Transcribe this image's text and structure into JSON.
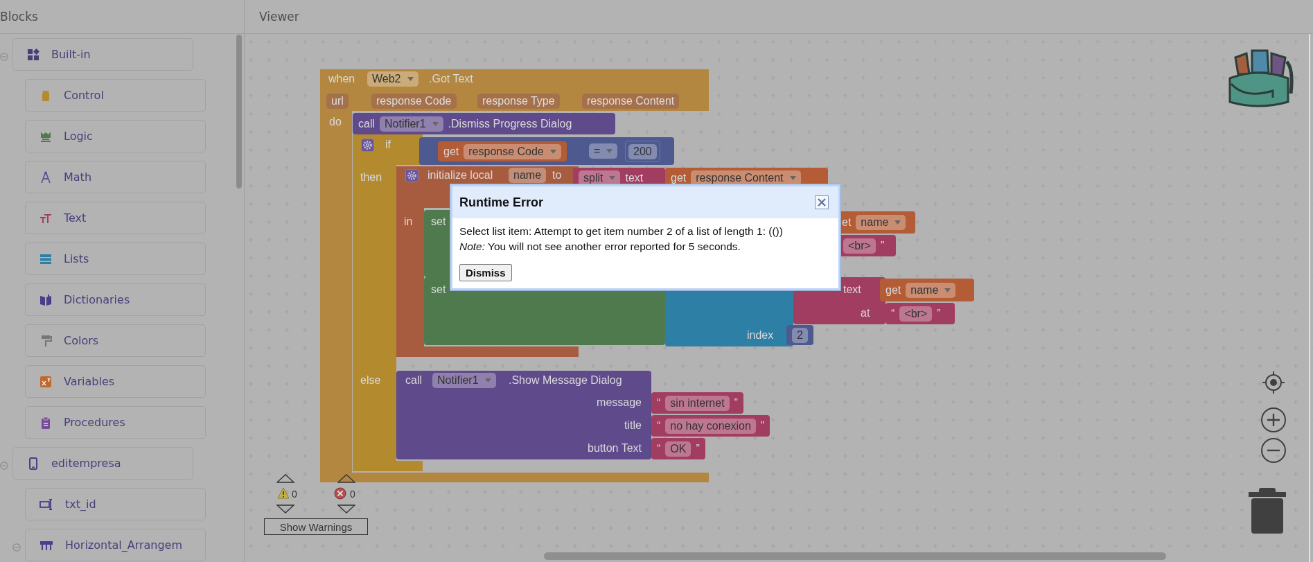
{
  "sidebar": {
    "title": "Blocks",
    "items": [
      {
        "label": "Built-in",
        "expanded": true,
        "children": [
          {
            "label": "Control"
          },
          {
            "label": "Logic"
          },
          {
            "label": "Math"
          },
          {
            "label": "Text"
          },
          {
            "label": "Lists"
          },
          {
            "label": "Dictionaries"
          },
          {
            "label": "Colors"
          },
          {
            "label": "Variables"
          },
          {
            "label": "Procedures"
          }
        ]
      },
      {
        "label": "editempresa",
        "expanded": true,
        "children": [
          {
            "label": "txt_id"
          },
          {
            "label": "Horizontal_Arrangem",
            "expanded": true
          }
        ]
      }
    ]
  },
  "viewer": {
    "title": "Viewer",
    "event_block": {
      "keyword": "when",
      "component": "Web2",
      "event": ".Got Text",
      "params": [
        "url",
        "response Code",
        "response Type",
        "response Content"
      ],
      "do_label": "do"
    },
    "dismiss_call": {
      "keyword": "call",
      "component": "Notifier1",
      "method": ".Dismiss Progress Dialog"
    },
    "if_block": {
      "if_label": "if",
      "then_label": "then",
      "else_label": "else",
      "condition": {
        "get": "get",
        "variable": "response Code",
        "operator": "=",
        "number": "200"
      }
    },
    "local_init": {
      "keyword": "initialize local",
      "name": "name",
      "to_label": "to",
      "in_label": "in",
      "split": "split",
      "text_label": "text",
      "get": "get",
      "variable": "response Content"
    },
    "set_blocks": [
      {
        "keyword": "set",
        "get": "et",
        "variable": "name",
        "separator": {
          "value": "<br>",
          "close": "”"
        }
      },
      {
        "keyword": "set",
        "text_label": "text",
        "get": "get",
        "variable": "name",
        "at_label": "at",
        "separator": {
          "open": "“",
          "value": "<br>",
          "close": "”"
        },
        "index_label": "index",
        "index": "2"
      }
    ],
    "show_dialog": {
      "keyword": "call",
      "component": "Notifier1",
      "method": ".Show Message Dialog",
      "args": [
        {
          "label": "message",
          "open": "“",
          "value": "sin internet",
          "close": "”"
        },
        {
          "label": "title",
          "open": "“",
          "value": "no hay conexion",
          "close": "”"
        },
        {
          "label": "button Text",
          "open": "“",
          "value": "OK",
          "close": "”"
        }
      ]
    },
    "warnings": {
      "warning_count": "0",
      "error_count": "0",
      "button": "Show Warnings"
    }
  },
  "dialog": {
    "title": "Runtime Error",
    "message": "Select list item: Attempt to get item number 2 of a list of length 1: (())",
    "note": "*Note:* You will not see another error reported for 5 seconds.",
    "button": "Dismiss"
  }
}
